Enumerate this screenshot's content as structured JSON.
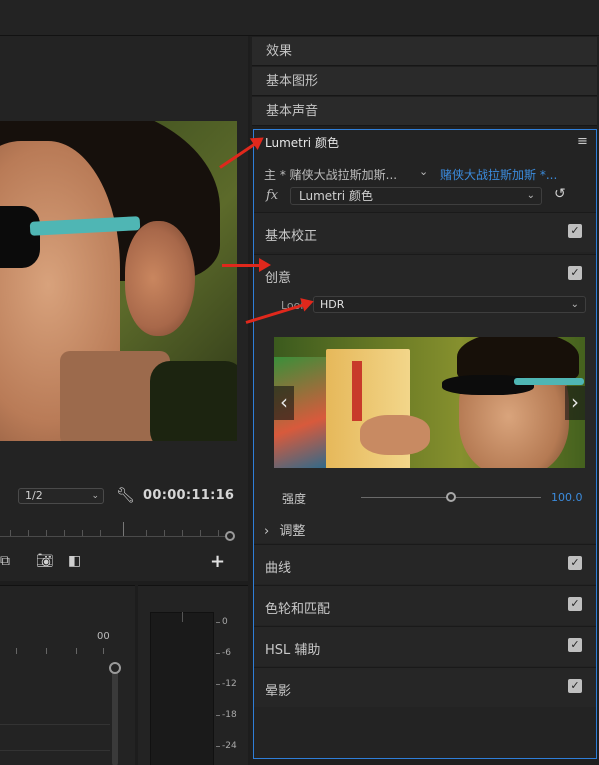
{
  "colors": {
    "accent_blue": "#2f7ed8",
    "link_blue": "#3b8bdc",
    "annotation_red": "#e0281c"
  },
  "monitor": {
    "zoom": "1/2",
    "timecode": "00:00:11:16"
  },
  "timeline": {
    "time_label": "00"
  },
  "meters": {
    "scale": [
      "0",
      "-6",
      "-12",
      "-18",
      "-24"
    ]
  },
  "panels": {
    "collapsed": [
      "效果",
      "基本图形",
      "基本声音"
    ]
  },
  "lumetri": {
    "title": "Lumetri 颜色",
    "menu_icon": "≡",
    "clip_master": "主 * 赌侠大战拉斯加斯...",
    "clip_sequence": "赌侠大战拉斯加斯 *...",
    "fx_label": "fx",
    "effect_select": "Lumetri 颜色",
    "sections": {
      "basic": "基本校正",
      "creative": "创意",
      "curves": "曲线",
      "wheels": "色轮和匹配",
      "hsl": "HSL 辅助",
      "vignette": "晕影"
    },
    "look_label": "Look",
    "look_value": "HDR",
    "intensity_label": "强度",
    "intensity_value": "100.0",
    "intensity_fraction": 0.5,
    "adjust_label": "调整"
  }
}
